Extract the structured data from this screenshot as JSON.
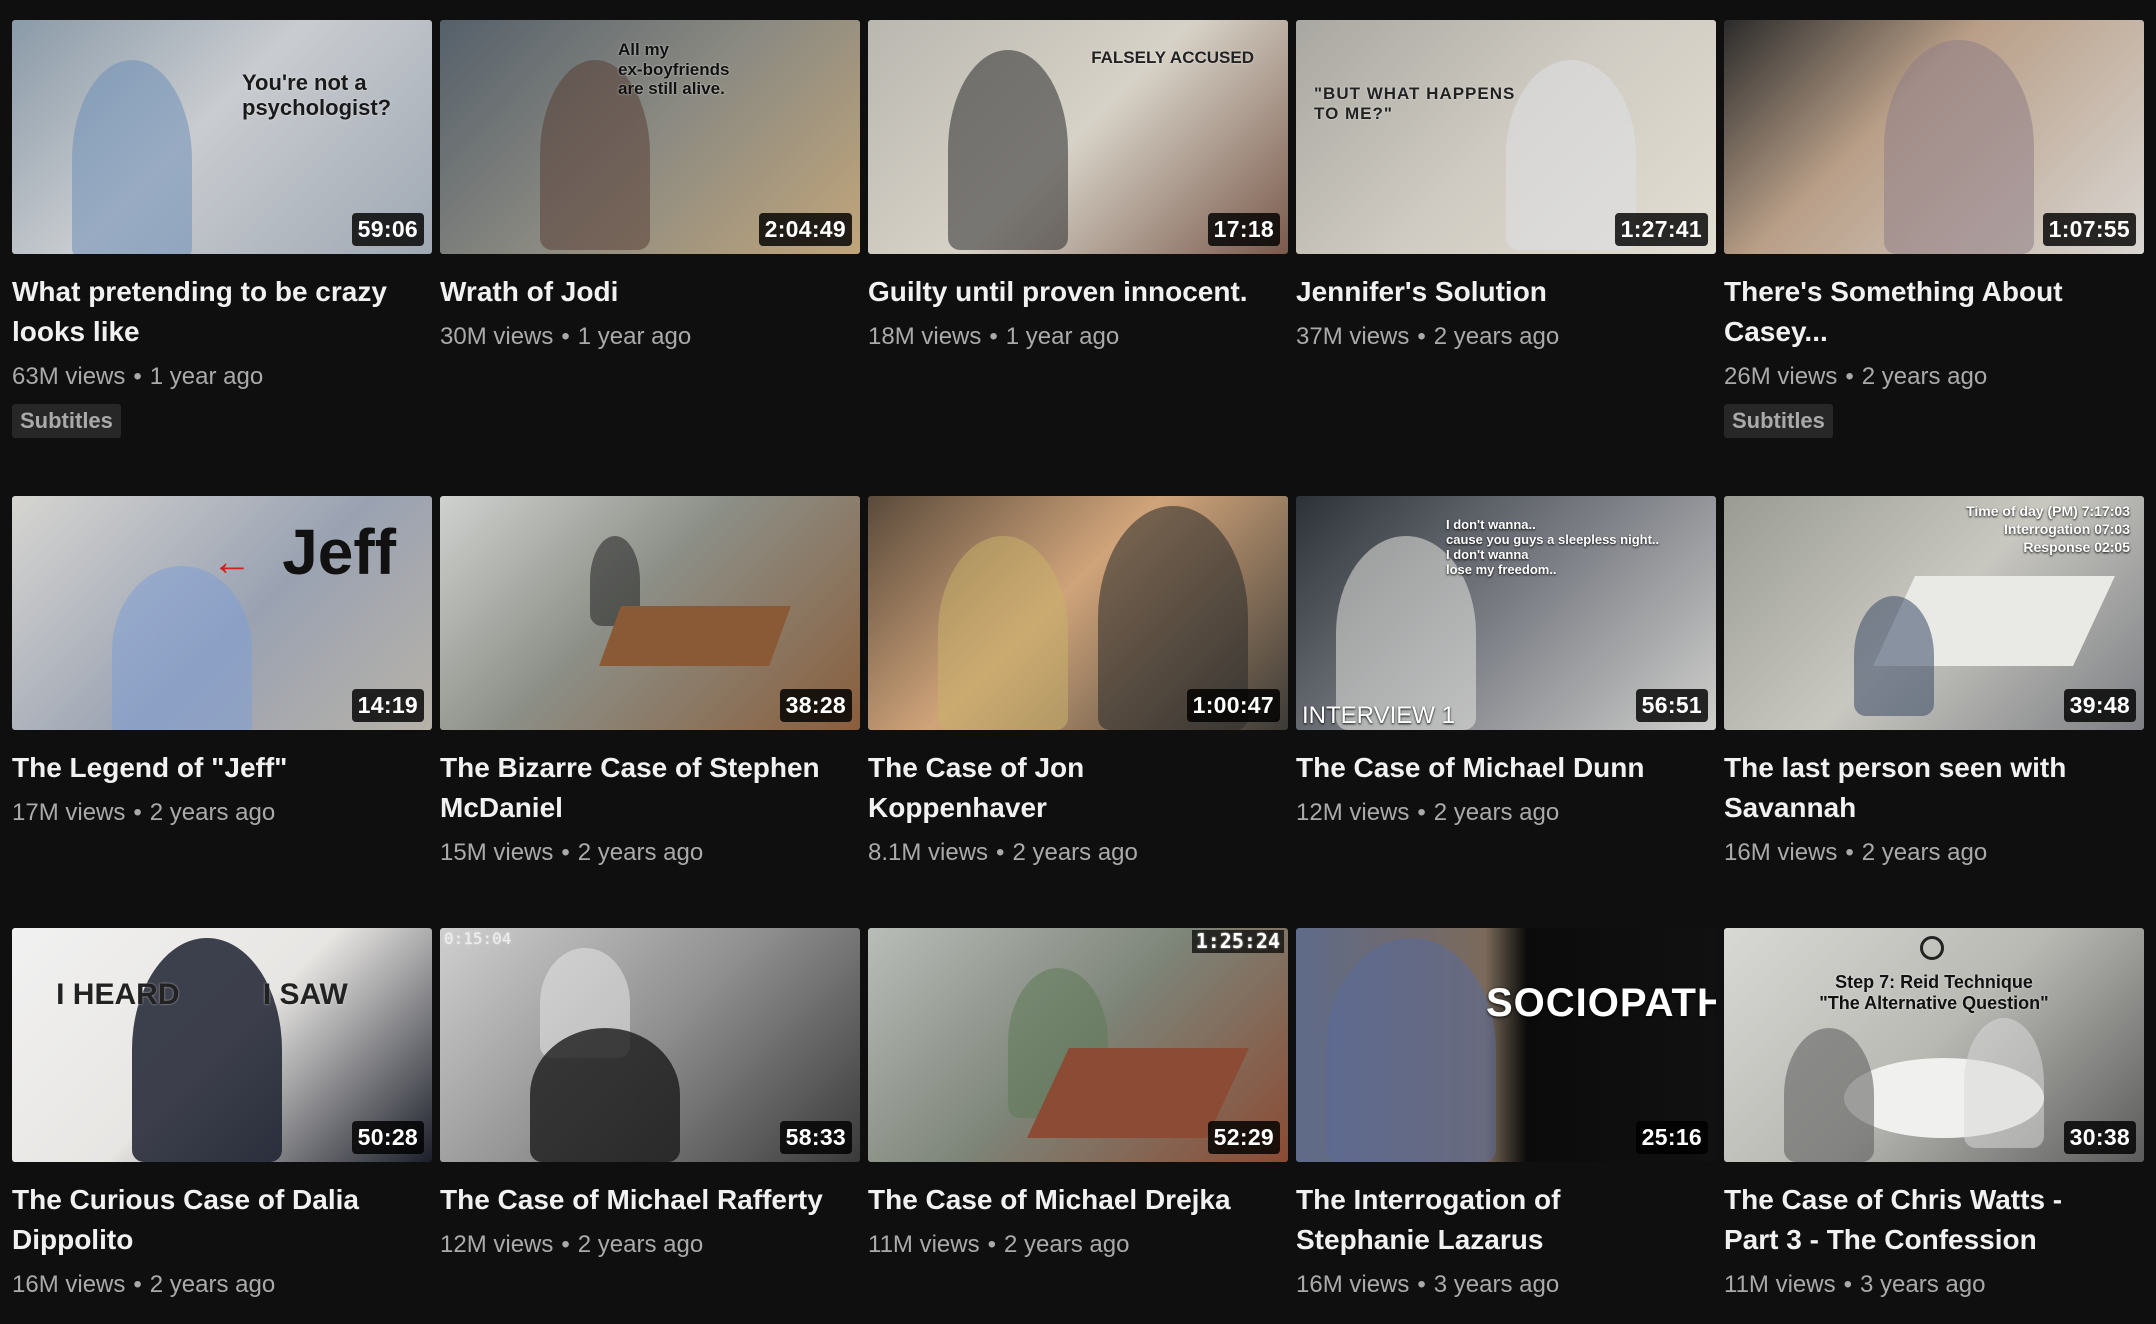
{
  "videos": [
    {
      "title": "What pretending to be crazy looks like",
      "views": "63M views",
      "age": "1 year ago",
      "duration": "59:06",
      "badge": "Subtitles",
      "overlay": "You're not a\npsychologist?"
    },
    {
      "title": "Wrath of Jodi",
      "views": "30M views",
      "age": "1 year ago",
      "duration": "2:04:49",
      "badge": "",
      "overlay": "All my\nex-boyfriends\nare still alive."
    },
    {
      "title": "Guilty until proven innocent.",
      "views": "18M views",
      "age": "1 year ago",
      "duration": "17:18",
      "badge": "",
      "overlay": "FALSELY ACCUSED"
    },
    {
      "title": "Jennifer's Solution",
      "views": "37M views",
      "age": "2 years ago",
      "duration": "1:27:41",
      "badge": "",
      "overlay": "\"BUT WHAT HAPPENS\n TO ME?\""
    },
    {
      "title": "There's Something About Casey...",
      "views": "26M views",
      "age": "2 years ago",
      "duration": "1:07:55",
      "badge": "Subtitles",
      "overlay": ""
    },
    {
      "title": "The Legend of \"Jeff\"",
      "views": "17M views",
      "age": "2 years ago",
      "duration": "14:19",
      "badge": "",
      "overlay": "Jeff"
    },
    {
      "title": "The Bizarre Case of Stephen McDaniel",
      "views": "15M views",
      "age": "2 years ago",
      "duration": "38:28",
      "badge": "",
      "overlay": ""
    },
    {
      "title": "The Case of Jon Koppenhaver",
      "views": "8.1M views",
      "age": "2 years ago",
      "duration": "1:00:47",
      "badge": "",
      "overlay": ""
    },
    {
      "title": "The Case of Michael Dunn",
      "views": "12M views",
      "age": "2 years ago",
      "duration": "56:51",
      "badge": "",
      "overlay": "I don't wanna..\ncause you guys a sleepless night..\nI don't wanna\nlose my freedom..",
      "overlay2": "INTERVIEW 1"
    },
    {
      "title": "The last person seen with Savannah",
      "views": "16M views",
      "age": "2 years ago",
      "duration": "39:48",
      "badge": "",
      "overlay": "Time of day (PM) 7:17:03\nInterrogation 07:03\nResponse 02:05"
    },
    {
      "title": "The Curious Case of Dalia Dippolito",
      "views": "16M views",
      "age": "2 years ago",
      "duration": "50:28",
      "badge": "",
      "overlay": "I HEARD          I SAW"
    },
    {
      "title": "The Case of Michael Rafferty",
      "views": "12M views",
      "age": "2 years ago",
      "duration": "58:33",
      "badge": "",
      "overlay": "0:15:04"
    },
    {
      "title": "The Case of Michael Drejka",
      "views": "11M views",
      "age": "2 years ago",
      "duration": "52:29",
      "badge": "",
      "overlay": "1:25:24"
    },
    {
      "title": "The Interrogation of Stephanie Lazarus",
      "views": "16M views",
      "age": "3 years ago",
      "duration": "25:16",
      "badge": "",
      "overlay": "SOCIOPATH"
    },
    {
      "title": "The Case of Chris Watts - Part 3 - The Confession",
      "views": "11M views",
      "age": "3 years ago",
      "duration": "30:38",
      "badge": "",
      "overlay": "Step 7: Reid Technique\n\"The Alternative Question\""
    }
  ],
  "colors": {
    "background": "#0f0f0f",
    "title": "#f1f1f1",
    "meta": "#aaaaaa",
    "badge_bg": "#272727"
  }
}
